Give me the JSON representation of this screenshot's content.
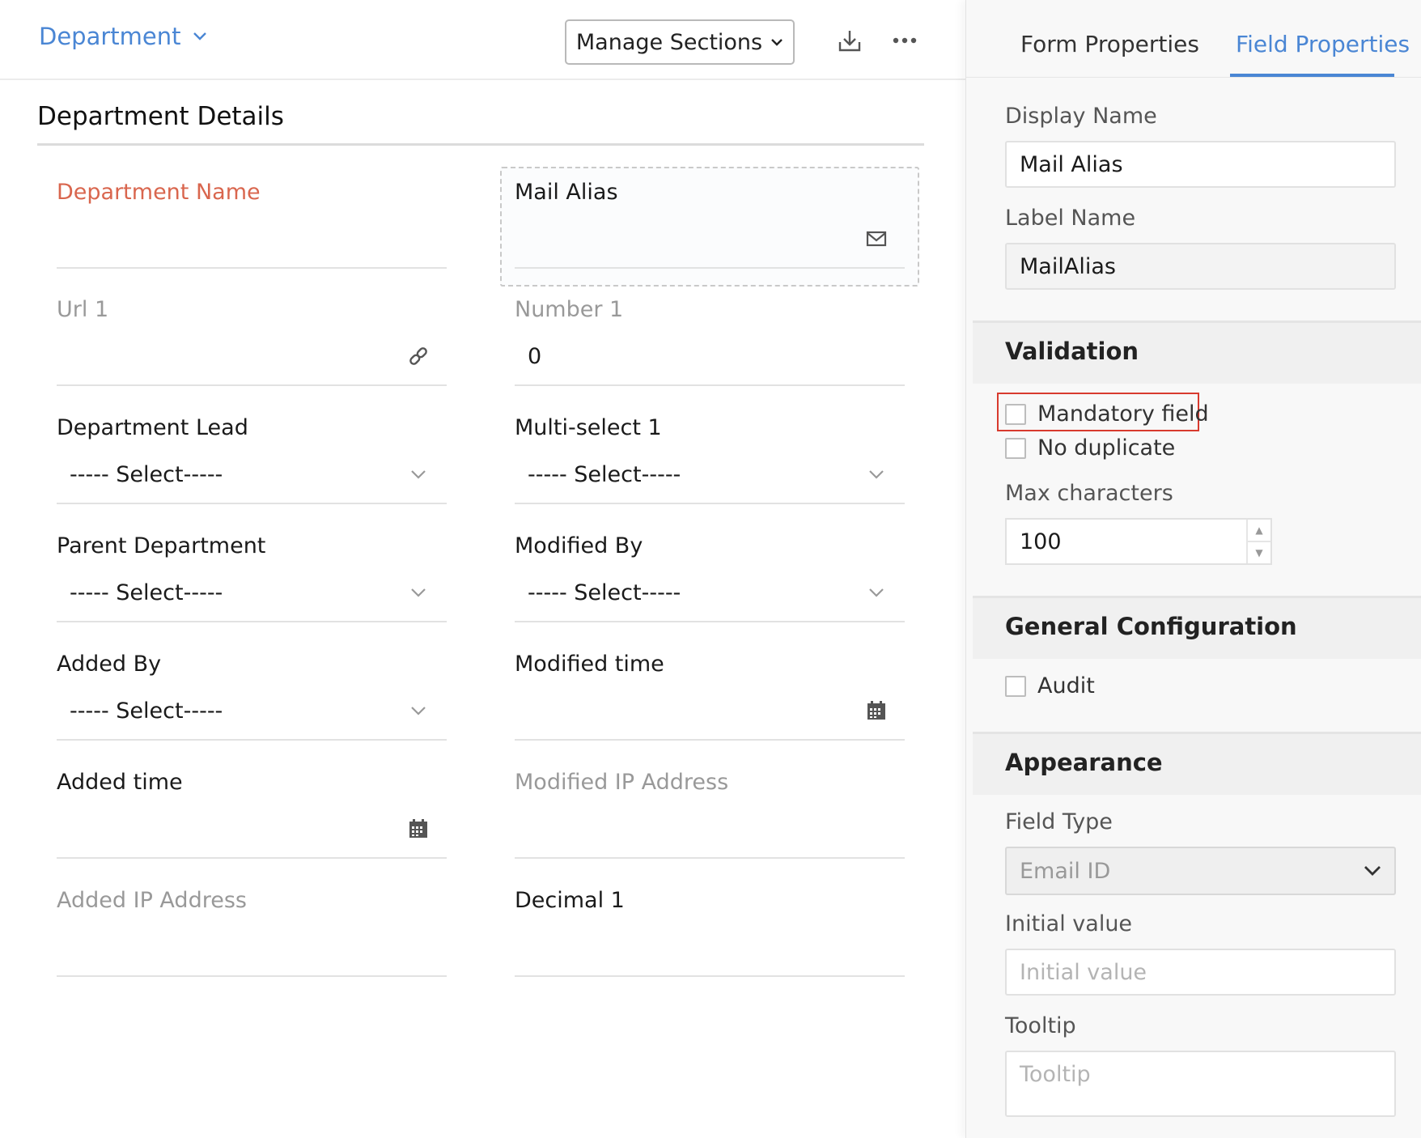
{
  "topbar": {
    "form_name": "Department",
    "manage_sections_label": "Manage Sections"
  },
  "section": {
    "title": "Department Details"
  },
  "fields": {
    "department_name": {
      "label": "Department Name"
    },
    "mail_alias": {
      "label": "Mail Alias"
    },
    "url1": {
      "label": "Url 1"
    },
    "number1": {
      "label": "Number 1",
      "value": "0"
    },
    "department_lead": {
      "label": "Department Lead",
      "value": "----- Select-----"
    },
    "multiselect1": {
      "label": "Multi-select 1",
      "value": "----- Select-----"
    },
    "parent_department": {
      "label": "Parent Department",
      "value": "----- Select-----"
    },
    "modified_by": {
      "label": "Modified By",
      "value": "----- Select-----"
    },
    "added_by": {
      "label": "Added By",
      "value": "----- Select-----"
    },
    "modified_time": {
      "label": "Modified time"
    },
    "added_time": {
      "label": "Added time"
    },
    "modified_ip": {
      "label": "Modified IP Address"
    },
    "added_ip": {
      "label": "Added IP Address"
    },
    "decimal1": {
      "label": "Decimal 1"
    }
  },
  "panel": {
    "tabs": {
      "form_properties": "Form Properties",
      "field_properties": "Field Properties"
    },
    "display_name": {
      "label": "Display Name",
      "value": "Mail Alias"
    },
    "label_name": {
      "label": "Label Name",
      "value": "MailAlias"
    },
    "validation": {
      "title": "Validation",
      "mandatory": "Mandatory field",
      "no_duplicate": "No duplicate",
      "max_chars_label": "Max characters",
      "max_chars_value": "100"
    },
    "general": {
      "title": "General Configuration",
      "audit": "Audit"
    },
    "appearance": {
      "title": "Appearance",
      "field_type_label": "Field Type",
      "field_type_value": "Email ID",
      "initial_value_label": "Initial value",
      "initial_value_placeholder": "Initial value",
      "tooltip_label": "Tooltip",
      "tooltip_placeholder": "Tooltip"
    }
  }
}
